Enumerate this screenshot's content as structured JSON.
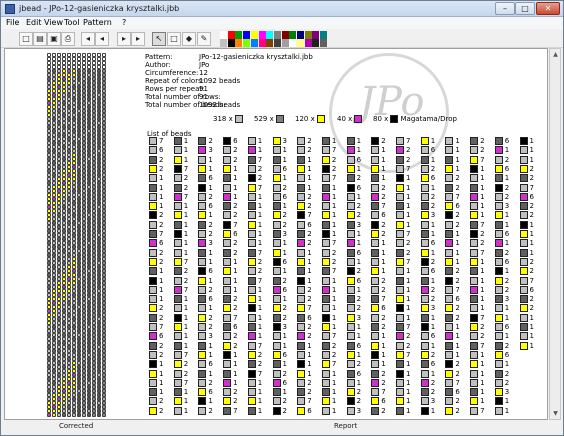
{
  "window": {
    "title": "jbead - JPo-12-gasieniczka krysztalki.jbb",
    "min_label": "–",
    "max_label": "□",
    "close_label": "✕"
  },
  "menu": [
    "File",
    "Edit",
    "View",
    "Tool",
    "Pattern",
    "?"
  ],
  "toolbar": {
    "buttons": [
      {
        "name": "new-file-icon",
        "glyph": "□"
      },
      {
        "name": "open-file-icon",
        "glyph": "▤"
      },
      {
        "name": "save-file-icon",
        "glyph": "▣"
      },
      {
        "name": "print-icon",
        "glyph": "⎙"
      },
      {
        "name": "arrow-first-icon",
        "glyph": "◂"
      },
      {
        "name": "arrow-prev-icon",
        "glyph": "◂"
      },
      {
        "name": "arrow-next-icon",
        "glyph": "▸"
      },
      {
        "name": "arrow-last-icon",
        "glyph": "▸"
      },
      {
        "name": "select-tool-icon",
        "glyph": "↖"
      },
      {
        "name": "rectangle-tool-icon",
        "glyph": "□"
      },
      {
        "name": "fill-tool-icon",
        "glyph": "◆"
      },
      {
        "name": "pipette-tool-icon",
        "glyph": "✎"
      }
    ],
    "palette": [
      "#ffffff",
      "#ff0000",
      "#00a000",
      "#0000ff",
      "#ffff00",
      "#ff00ff",
      "#00ffff",
      "#808080",
      "#800000",
      "#008000",
      "#000080",
      "#808000",
      "#800080",
      "#008080",
      "#c0c0c0",
      "#000000",
      "#ff8000",
      "#80ff00",
      "#0080ff",
      "#ff0080",
      "#804000",
      "#404040",
      "#a0a0a0",
      "#ffffff",
      "#ffff80",
      "#b000b0",
      "#202020",
      "#606060"
    ]
  },
  "pattern_info": [
    {
      "key": "Pattern:",
      "value": "JPo-12-gasieniczka krysztalki.jbb"
    },
    {
      "key": "Author:",
      "value": "JPo"
    },
    {
      "key": "Circumference:",
      "value": "12"
    },
    {
      "key": "Repeat of colors:",
      "value": "1092 beads"
    },
    {
      "key": "Rows per repeat:",
      "value": "91"
    },
    {
      "key": "Total number of rows:",
      "value": "91"
    },
    {
      "key": "Total number of beads:",
      "value": "1092 beads"
    }
  ],
  "color_counts": [
    {
      "count": "318 x",
      "color": "#c0c0c0"
    },
    {
      "count": "529 x",
      "color": "#808080"
    },
    {
      "count": "120 x",
      "color": "#ffff00"
    },
    {
      "count": "40 x",
      "color": "#cc33cc"
    },
    {
      "count": "80 x",
      "color": "#000000",
      "note": "Magatama/Drop"
    }
  ],
  "bead_colors": {
    "L": "#c0c0c0",
    "D": "#606060",
    "Y": "#ffff00",
    "M": "#cc33cc",
    "K": "#000000"
  },
  "list_title": "List of beads",
  "labels": {
    "corrected": "Corrected",
    "report": "Report"
  },
  "watermark": {
    "text": "JPo"
  }
}
